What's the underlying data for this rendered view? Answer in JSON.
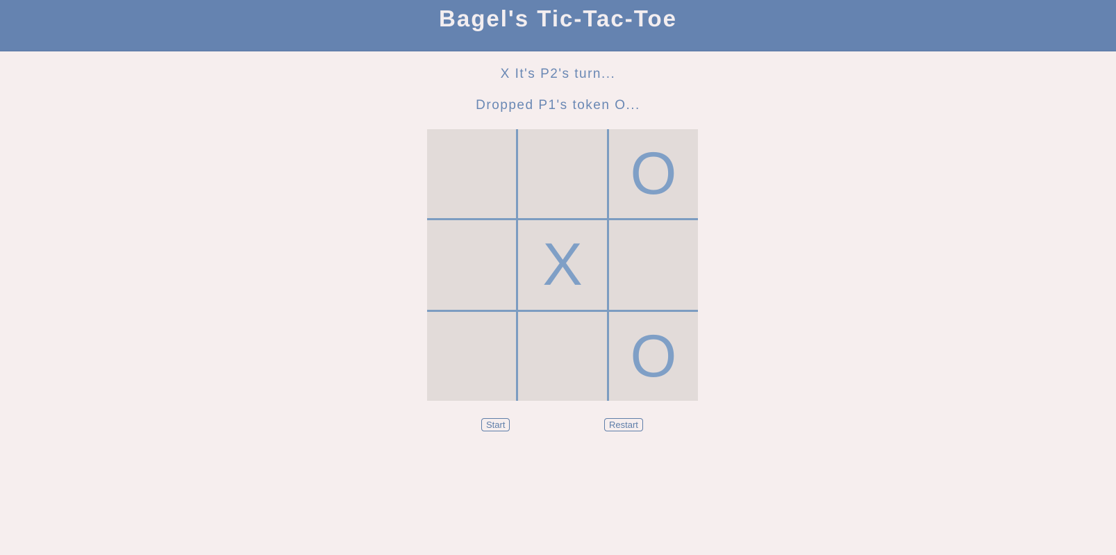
{
  "header": {
    "title": "Bagel's Tic-Tac-Toe"
  },
  "status": {
    "turn_message": "X It's P2's turn...",
    "drop_message": "Dropped P1's token O..."
  },
  "board": {
    "cells": [
      "",
      "",
      "O",
      "",
      "X",
      "",
      "",
      "",
      "O"
    ]
  },
  "controls": {
    "start_label": "Start",
    "restart_label": "Restart"
  },
  "colors": {
    "header_background": "#6583b0",
    "page_background": "#f6eeee",
    "board_background": "#e2dbd9",
    "accent": "#7f9fc6"
  }
}
